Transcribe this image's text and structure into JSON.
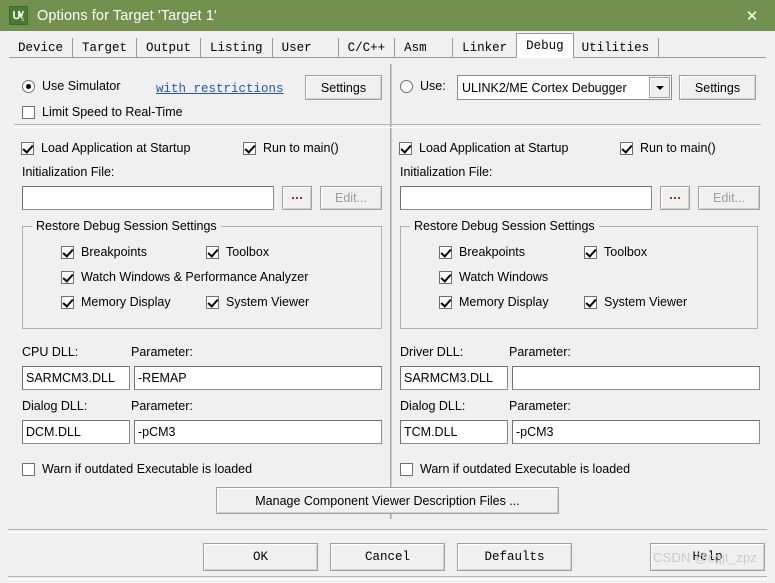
{
  "window": {
    "title": "Options for Target 'Target 1'",
    "icon": "uvision-logo-icon",
    "close_label": "✕",
    "titlebar_color": "#72914f"
  },
  "tabs": [
    {
      "label": "Device",
      "active": false
    },
    {
      "label": "Target",
      "active": false
    },
    {
      "label": "Output",
      "active": false
    },
    {
      "label": "Listing",
      "active": false
    },
    {
      "label": "User",
      "active": false
    },
    {
      "label": "C/C++",
      "active": false
    },
    {
      "label": "Asm",
      "active": false
    },
    {
      "label": "Linker",
      "active": false
    },
    {
      "label": "Debug",
      "active": true
    },
    {
      "label": "Utilities",
      "active": false
    }
  ],
  "left_panel": {
    "use_simulator": {
      "label": "Use Simulator",
      "checked": true
    },
    "restrictions_link": "with restrictions",
    "settings_button": "Settings",
    "limit_speed": {
      "label": "Limit Speed to Real-Time",
      "checked": false
    },
    "load_app": {
      "label": "Load Application at Startup",
      "checked": true
    },
    "run_to_main": {
      "label": "Run to main()",
      "checked": true
    },
    "init_file_label": "Initialization File:",
    "init_file_value": "",
    "browse_button": "...",
    "edit_button": "Edit...",
    "restore_group": {
      "legend": "Restore Debug Session Settings",
      "breakpoints": {
        "label": "Breakpoints",
        "checked": true
      },
      "toolbox": {
        "label": "Toolbox",
        "checked": true
      },
      "watch": {
        "label": "Watch Windows & Performance Analyzer",
        "checked": true
      },
      "memory": {
        "label": "Memory Display",
        "checked": true
      },
      "sysviewer": {
        "label": "System Viewer",
        "checked": true
      }
    },
    "cpu_dll_label": "CPU DLL:",
    "cpu_dll_value": "SARMCM3.DLL",
    "cpu_param_label": "Parameter:",
    "cpu_param_value": "-REMAP",
    "dialog_dll_label": "Dialog DLL:",
    "dialog_dll_value": "DCM.DLL",
    "dialog_param_label": "Parameter:",
    "dialog_param_value": "-pCM3",
    "warn_outdated": {
      "label": "Warn if outdated Executable is loaded",
      "checked": false
    }
  },
  "right_panel": {
    "use_driver": {
      "label": "Use:",
      "checked": false
    },
    "driver_selected": "ULINK2/ME Cortex Debugger",
    "settings_button": "Settings",
    "load_app": {
      "label": "Load Application at Startup",
      "checked": true
    },
    "run_to_main": {
      "label": "Run to main()",
      "checked": true
    },
    "init_file_label": "Initialization File:",
    "init_file_value": "",
    "browse_button": "...",
    "edit_button": "Edit...",
    "restore_group": {
      "legend": "Restore Debug Session Settings",
      "breakpoints": {
        "label": "Breakpoints",
        "checked": true
      },
      "toolbox": {
        "label": "Toolbox",
        "checked": true
      },
      "watch": {
        "label": "Watch Windows",
        "checked": true
      },
      "memory": {
        "label": "Memory Display",
        "checked": true
      },
      "sysviewer": {
        "label": "System Viewer",
        "checked": true
      }
    },
    "driver_dll_label": "Driver DLL:",
    "driver_dll_value": "SARMCM3.DLL",
    "driver_param_label": "Parameter:",
    "driver_param_value": "",
    "dialog_dll_label": "Dialog DLL:",
    "dialog_dll_value": "TCM.DLL",
    "dialog_param_label": "Parameter:",
    "dialog_param_value": "-pCM3",
    "warn_outdated": {
      "label": "Warn if outdated Executable is loaded",
      "checked": false
    }
  },
  "manage_button": "Manage Component Viewer Description Files ...",
  "footer": {
    "ok": "OK",
    "cancel": "Cancel",
    "defaults": "Defaults",
    "help": "Help"
  },
  "watermark": "CSDN @cqjt_zpz"
}
